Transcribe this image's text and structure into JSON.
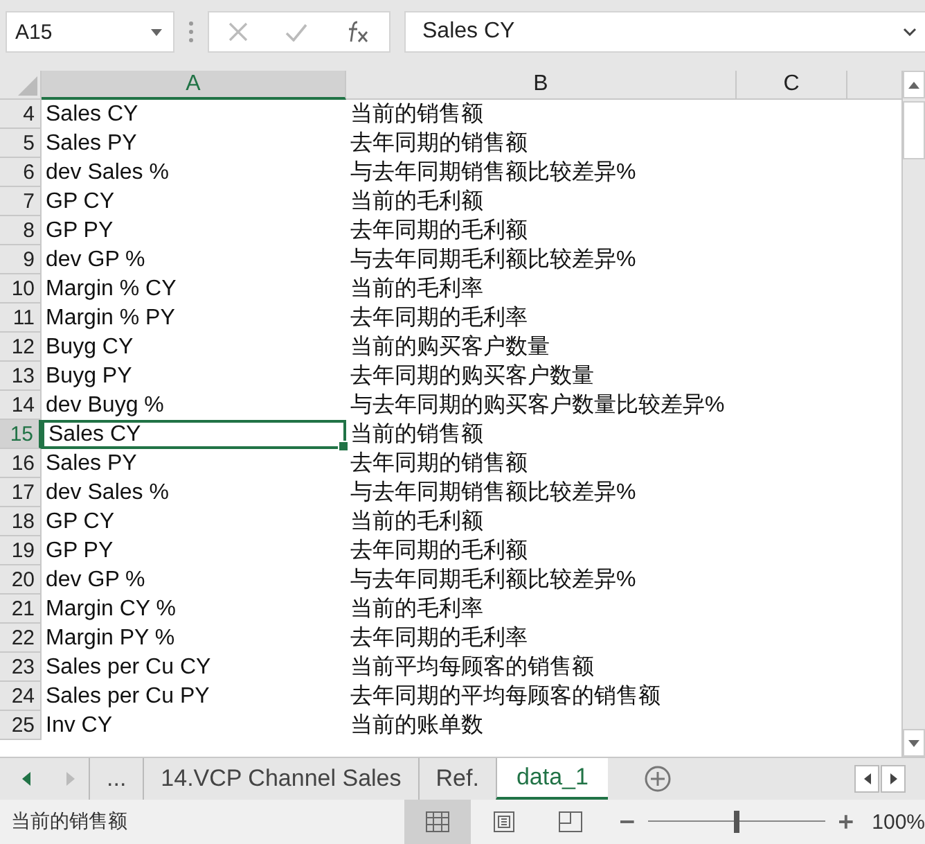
{
  "name_box": "A15",
  "formula": "Sales CY",
  "columns": [
    {
      "label": "A",
      "selected": true
    },
    {
      "label": "B",
      "selected": false
    },
    {
      "label": "C",
      "selected": false
    }
  ],
  "rows": [
    {
      "n": "4",
      "a": "Sales CY",
      "b": "当前的销售额",
      "selected": false
    },
    {
      "n": "5",
      "a": "Sales PY",
      "b": "去年同期的销售额",
      "selected": false
    },
    {
      "n": "6",
      "a": "dev Sales %",
      "b": "与去年同期销售额比较差异%",
      "selected": false
    },
    {
      "n": "7",
      "a": "GP CY",
      "b": "当前的毛利额",
      "selected": false
    },
    {
      "n": "8",
      "a": "GP PY",
      "b": "去年同期的毛利额",
      "selected": false
    },
    {
      "n": "9",
      "a": "dev GP %",
      "b": "与去年同期毛利额比较差异%",
      "selected": false
    },
    {
      "n": "10",
      "a": "Margin % CY",
      "b": "当前的毛利率",
      "selected": false
    },
    {
      "n": "11",
      "a": "Margin % PY",
      "b": "去年同期的毛利率",
      "selected": false
    },
    {
      "n": "12",
      "a": "Buyg CY",
      "b": "当前的购买客户数量",
      "selected": false
    },
    {
      "n": "13",
      "a": "Buyg PY",
      "b": "去年同期的购买客户数量",
      "selected": false
    },
    {
      "n": "14",
      "a": "dev Buyg %",
      "b": "与去年同期的购买客户数量比较差异%",
      "selected": false
    },
    {
      "n": "15",
      "a": "Sales CY",
      "b": "当前的销售额",
      "selected": true
    },
    {
      "n": "16",
      "a": "Sales PY",
      "b": "去年同期的销售额",
      "selected": false
    },
    {
      "n": "17",
      "a": "dev Sales %",
      "b": "与去年同期销售额比较差异%",
      "selected": false
    },
    {
      "n": "18",
      "a": "GP CY",
      "b": "当前的毛利额",
      "selected": false
    },
    {
      "n": "19",
      "a": "GP PY",
      "b": "去年同期的毛利额",
      "selected": false
    },
    {
      "n": "20",
      "a": "dev GP %",
      "b": "与去年同期毛利额比较差异%",
      "selected": false
    },
    {
      "n": "21",
      "a": "Margin CY %",
      "b": "当前的毛利率",
      "selected": false
    },
    {
      "n": "22",
      "a": "Margin PY %",
      "b": "去年同期的毛利率",
      "selected": false
    },
    {
      "n": "23",
      "a": "Sales per Cu CY",
      "b": "当前平均每顾客的销售额",
      "selected": false
    },
    {
      "n": "24",
      "a": "Sales per Cu PY",
      "b": "去年同期的平均每顾客的销售额",
      "selected": false
    },
    {
      "n": "25",
      "a": "Inv CY",
      "b": "当前的账单数",
      "selected": false
    }
  ],
  "sheet_tabs": [
    {
      "label": "...",
      "selected": false
    },
    {
      "label": "14.VCP Channel Sales",
      "selected": false
    },
    {
      "label": "Ref.",
      "selected": false
    },
    {
      "label": "data_1",
      "selected": true
    }
  ],
  "status_bar": {
    "message": "当前的销售额",
    "views": [
      {
        "kind": "normal",
        "selected": true
      },
      {
        "kind": "page_layout",
        "selected": false
      },
      {
        "kind": "page_break",
        "selected": false
      }
    ],
    "zoom": {
      "level": 0.5,
      "reading": "100%"
    }
  }
}
